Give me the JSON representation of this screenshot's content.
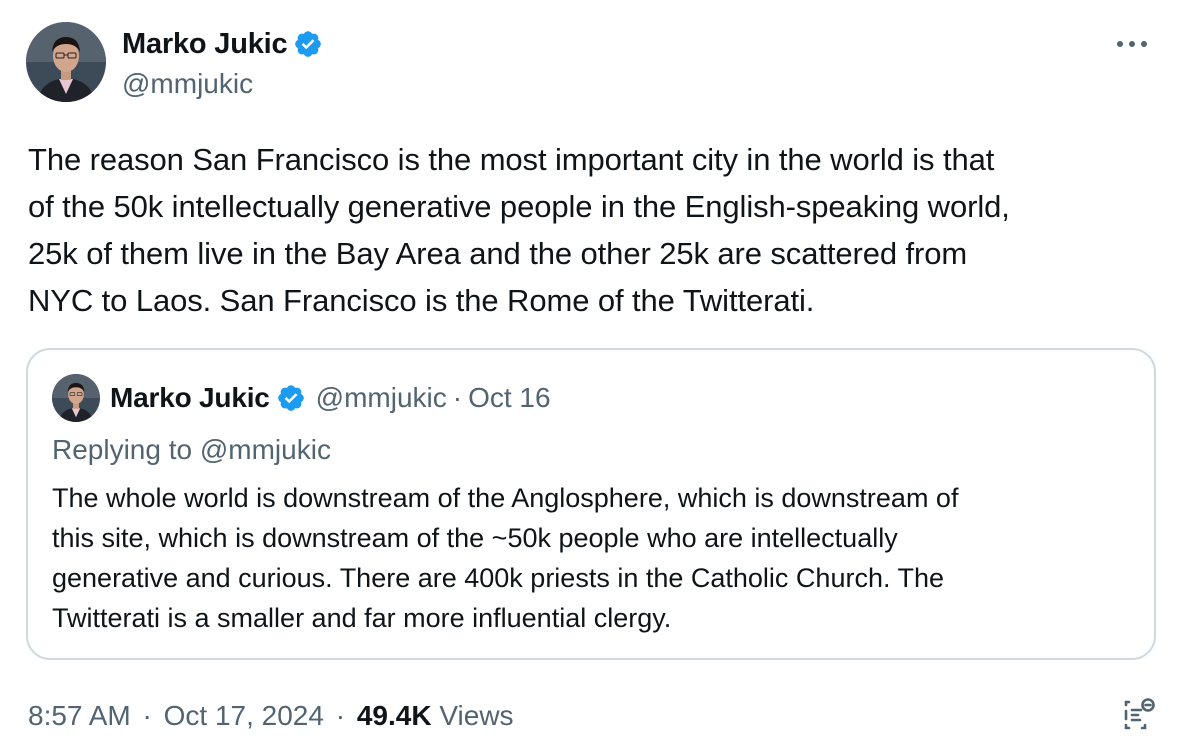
{
  "author": {
    "name": "Marko Jukic",
    "handle": "@mmjukic"
  },
  "tweet": {
    "text": "The reason San Francisco is the most important city in the world is that\nof the 50k intellectually generative people in the English-speaking world,\n25k of them live in the Bay Area and the other 25k are scattered from\nNYC to Laos. San Francisco is the Rome of the Twitterati."
  },
  "quoted": {
    "name": "Marko Jukic",
    "handle": "@mmjukic",
    "separator": "·",
    "date": "Oct 16",
    "replying_to": "Replying to @mmjukic",
    "text": "The whole world is downstream of the Anglosphere, which is downstream of\nthis site, which is downstream of the ~50k people who are intellectually\ngenerative and curious. There are 400k priests in the Catholic Church. The\nTwitterati is a smaller and far more influential clergy."
  },
  "footer": {
    "time": "8:57 AM",
    "separator": "·",
    "date": "Oct 17, 2024",
    "views_count": "49.4K",
    "views_label": "Views"
  },
  "icons": {
    "verified": "verified-badge-icon",
    "more": "more-options-icon",
    "analytics": "analytics-icon"
  },
  "colors": {
    "verified_blue": "#1d9bf0",
    "text_primary": "#0f1419",
    "text_secondary": "#536471",
    "border": "#cfd9de"
  }
}
